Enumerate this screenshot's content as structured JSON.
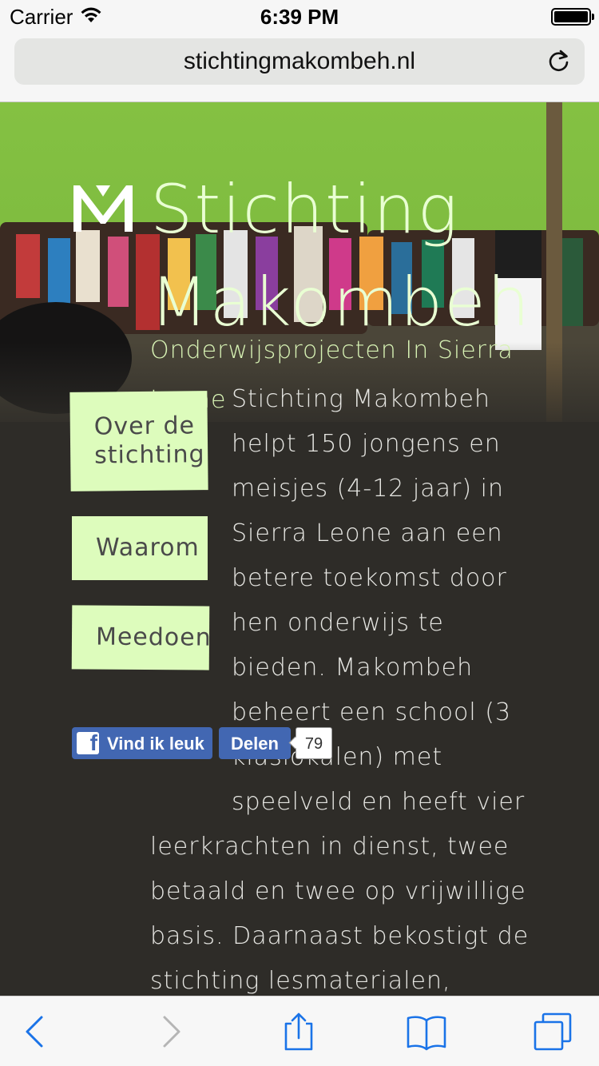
{
  "status_bar": {
    "carrier": "Carrier",
    "time": "6:39 PM"
  },
  "browser": {
    "url": "stichtingmakombeh.nl"
  },
  "site": {
    "title": "Stichting Makombeh",
    "subtitle": "Onderwijsprojecten In Sierra Leone"
  },
  "nav": {
    "items": [
      {
        "label": "Over de stichting"
      },
      {
        "label": "Waarom"
      },
      {
        "label": "Meedoen"
      }
    ]
  },
  "social": {
    "like_label": "Vind ik leuk",
    "share_label": "Delen",
    "share_count": "79"
  },
  "content": {
    "intro": "Stichting Makombeh helpt 150 jongens en meisjes (4-12 jaar) in Sierra Leone aan een betere toekomst door hen onderwijs te bieden. Makombeh beheert een school (3 klaslokalen) met speelveld en heeft vier leerkrachten in dienst, twee betaald en twee op vrijwillige basis. Daarnaast bekostigt de stichting lesmaterialen,"
  },
  "colors": {
    "page_bg": "#2e2c28",
    "note_bg": "#ddfcbc",
    "title_green": "#e9ffd3",
    "facebook_blue": "#4267b2",
    "ios_blue": "#1a73e8"
  },
  "icons": {
    "toolbar": [
      "back-icon",
      "forward-icon",
      "share-icon",
      "bookmarks-icon",
      "tabs-icon"
    ]
  }
}
